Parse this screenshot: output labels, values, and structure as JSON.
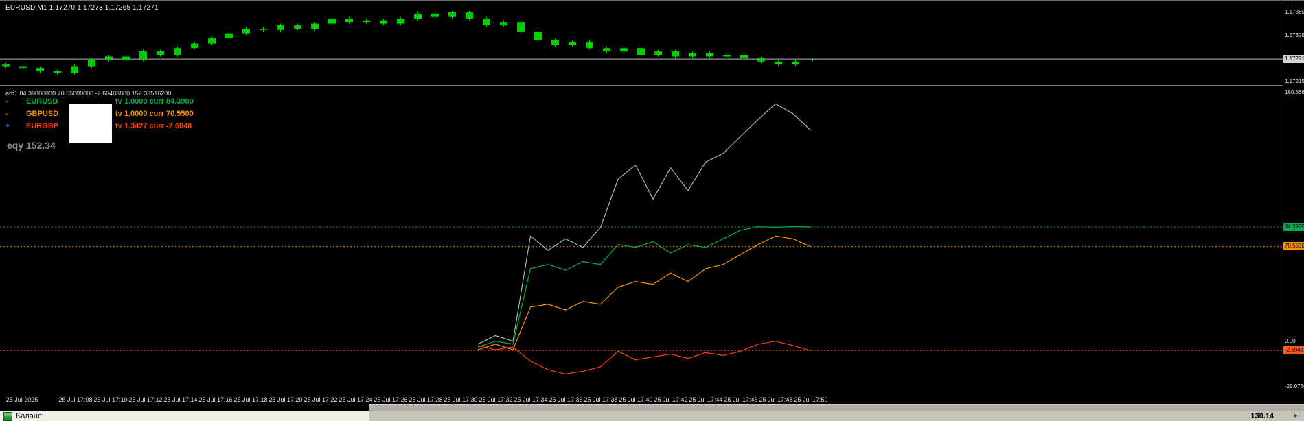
{
  "colors": {
    "background": "#000000",
    "bull_candle": "#00d000",
    "price_line": "#b8b8b8",
    "price_badge_bg": "#d4d4d4",
    "equity_line": "#b4b4b4",
    "axis_text": "#e0e0e0"
  },
  "main_chart": {
    "title": "EURUSD,M1 1.17270 1.17273 1.17265 1.17271",
    "axis_labels": [
      {
        "text": "1.17380"
      },
      {
        "text": "1.17325"
      },
      {
        "text": "1.17215"
      }
    ],
    "price_badge": {
      "text": "1.17271"
    }
  },
  "indicator": {
    "title": "arb1 84.39000000 70.55000000 -2.60483800 152.33516200",
    "legend": [
      {
        "icon": "-",
        "icon_color": "#ff2a2a",
        "symbol": "EURUSD",
        "detail": "tv 1.0000 curr 84.3900",
        "color": "#00b050"
      },
      {
        "icon": "-",
        "icon_color": "#ff2a2a",
        "symbol": "GBPUSD",
        "detail": "tv 1.0000 curr 70.5500",
        "color": "#ff9100"
      },
      {
        "icon": "+",
        "icon_color": "#4455ff",
        "symbol": "EURGBP",
        "detail": "tv 1.3427 curr -2.6048",
        "color": "#ff4000"
      }
    ],
    "equity_label": "eqy 152.34",
    "axis": {
      "top_label": "180.6667",
      "zero_label": "0.00",
      "bottom_label": "-29.0760",
      "badges": [
        {
          "text": "84.3900",
          "bg": "#00b050"
        },
        {
          "text": "70.5500",
          "bg": "#ff9100"
        },
        {
          "text": "-2.6048",
          "bg": "#ff5a1e"
        }
      ]
    }
  },
  "time_axis": {
    "date_label": "25 Jul 2025",
    "labels": [
      "25 Jul 17:08",
      "25 Jul 17:10",
      "25 Jul 17:12",
      "25 Jul 17:14",
      "25 Jul 17:16",
      "25 Jul 17:18",
      "25 Jul 17:20",
      "25 Jul 17:22",
      "25 Jul 17:24",
      "25 Jul 17:26",
      "25 Jul 17:28",
      "25 Jul 17:30",
      "25 Jul 17:32",
      "25 Jul 17:34",
      "25 Jul 17:36",
      "25 Jul 17:38",
      "25 Jul 17:40",
      "25 Jul 17:42",
      "25 Jul 17:44",
      "25 Jul 17:46",
      "25 Jul 17:48",
      "25 Jul 17:50"
    ]
  },
  "status_bar": {
    "balance_label": "Баланс:",
    "balance_value": "130.14",
    "arrow_glyph": "▸"
  },
  "chart_data": [
    {
      "type": "candlestick",
      "symbol": "EURUSD",
      "timeframe": "M1",
      "last_ohlc": {
        "open": 1.1727,
        "high": 1.17273,
        "low": 1.17265,
        "close": 1.17271
      },
      "current_price": 1.17271,
      "ylim": [
        1.17215,
        1.174
      ],
      "candles": [
        [
          1.17258,
          1.17262,
          1.1725,
          1.17254
        ],
        [
          1.17254,
          1.17258,
          1.17246,
          1.1725
        ],
        [
          1.1725,
          1.17254,
          1.17238,
          1.17242
        ],
        [
          1.17242,
          1.17246,
          1.17234,
          1.17238
        ],
        [
          1.17238,
          1.17258,
          1.17234,
          1.17254
        ],
        [
          1.17254,
          1.17273,
          1.1725,
          1.17269
        ],
        [
          1.17269,
          1.17281,
          1.17265,
          1.17277
        ],
        [
          1.17277,
          1.17281,
          1.17265,
          1.17269
        ],
        [
          1.17269,
          1.17293,
          1.17265,
          1.17289
        ],
        [
          1.17289,
          1.17293,
          1.17277,
          1.17281
        ],
        [
          1.17281,
          1.17301,
          1.17277,
          1.17297
        ],
        [
          1.17297,
          1.17312,
          1.17293,
          1.17308
        ],
        [
          1.17308,
          1.17324,
          1.17304,
          1.1732
        ],
        [
          1.1732,
          1.17336,
          1.17316,
          1.17332
        ],
        [
          1.17332,
          1.17347,
          1.17328,
          1.17343
        ],
        [
          1.17343,
          1.17347,
          1.17336,
          1.1734
        ],
        [
          1.1734,
          1.17355,
          1.17336,
          1.17351
        ],
        [
          1.17351,
          1.17355,
          1.17339,
          1.17343
        ],
        [
          1.17343,
          1.17359,
          1.17339,
          1.17355
        ],
        [
          1.17355,
          1.17371,
          1.17351,
          1.17367
        ],
        [
          1.17367,
          1.17371,
          1.17355,
          1.17359
        ],
        [
          1.17359,
          1.17367,
          1.17355,
          1.17363
        ],
        [
          1.17363,
          1.17367,
          1.17351,
          1.17355
        ],
        [
          1.17355,
          1.17371,
          1.17351,
          1.17367
        ],
        [
          1.17367,
          1.17383,
          1.17363,
          1.17379
        ],
        [
          1.17379,
          1.17383,
          1.17367,
          1.17371
        ],
        [
          1.17371,
          1.17386,
          1.17367,
          1.17382
        ],
        [
          1.17382,
          1.17386,
          1.17363,
          1.17367
        ],
        [
          1.17367,
          1.17371,
          1.17347,
          1.17351
        ],
        [
          1.17351,
          1.17363,
          1.17347,
          1.17359
        ],
        [
          1.17359,
          1.17363,
          1.17332,
          1.17336
        ],
        [
          1.17336,
          1.1734,
          1.17312,
          1.17316
        ],
        [
          1.17316,
          1.1732,
          1.173,
          1.17304
        ],
        [
          1.17304,
          1.17316,
          1.173,
          1.17312
        ],
        [
          1.17312,
          1.17316,
          1.17293,
          1.17297
        ],
        [
          1.17297,
          1.17301,
          1.17285,
          1.17289
        ],
        [
          1.17289,
          1.17301,
          1.17285,
          1.17297
        ],
        [
          1.17297,
          1.17301,
          1.17277,
          1.17281
        ],
        [
          1.17281,
          1.17293,
          1.17277,
          1.17289
        ],
        [
          1.17289,
          1.17293,
          1.17273,
          1.17277
        ],
        [
          1.17277,
          1.17289,
          1.17273,
          1.17285
        ],
        [
          1.17285,
          1.17289,
          1.17273,
          1.17277
        ],
        [
          1.17277,
          1.17285,
          1.17273,
          1.17281
        ],
        [
          1.17281,
          1.17285,
          1.17269,
          1.17273
        ],
        [
          1.17273,
          1.17277,
          1.17261,
          1.17265
        ],
        [
          1.17265,
          1.17269,
          1.17254,
          1.17258
        ],
        [
          1.17258,
          1.17269,
          1.17254,
          1.17265
        ],
        [
          1.1727,
          1.17273,
          1.17265,
          1.17271
        ]
      ]
    },
    {
      "type": "line",
      "title": "arb1",
      "x": [
        "17:31",
        "17:32",
        "17:33",
        "17:34",
        "17:35",
        "17:36",
        "17:37",
        "17:38",
        "17:39",
        "17:40",
        "17:41",
        "17:42",
        "17:43",
        "17:44",
        "17:45",
        "17:46",
        "17:47",
        "17:48",
        "17:49",
        "17:50"
      ],
      "ylim": [
        -29.076,
        180.6667
      ],
      "legend_position": "top-left",
      "levels": [
        {
          "value": 84.39,
          "color": "#00b050"
        },
        {
          "value": 70.55,
          "color": "#ff9100"
        },
        {
          "value": -2.6048,
          "color": "#ff4000"
        }
      ],
      "series": [
        {
          "name": "equity",
          "color": "#b4b4b4",
          "values": [
            2,
            8,
            4,
            78,
            68,
            76,
            70,
            84,
            118,
            128,
            104,
            126,
            110,
            130,
            136,
            148,
            160,
            171,
            164,
            152.34
          ]
        },
        {
          "name": "EURUSD",
          "color": "#00b050",
          "values": [
            0,
            4,
            2,
            55,
            58,
            54,
            60,
            58,
            72,
            70,
            74,
            66,
            72,
            70,
            76,
            82,
            84.5,
            84.2,
            84.6,
            84.39
          ]
        },
        {
          "name": "GBPUSD",
          "color": "#ff9100",
          "values": [
            -2,
            2,
            -2,
            28,
            30,
            26,
            32,
            30,
            42,
            46,
            44,
            52,
            46,
            55,
            58,
            65,
            72,
            78,
            76,
            70.55
          ]
        },
        {
          "name": "EURGBP",
          "color": "#ff4000",
          "values": [
            1,
            -2,
            0,
            -10,
            -16,
            -19,
            -17,
            -14,
            -3,
            -9,
            -7,
            -5,
            -8,
            -4,
            -6,
            -3,
            2,
            4,
            1,
            -2.6048
          ]
        }
      ]
    }
  ]
}
